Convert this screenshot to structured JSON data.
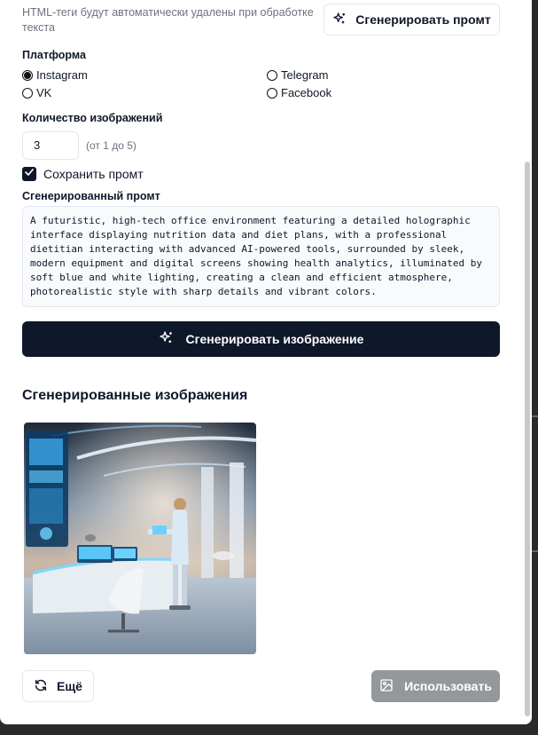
{
  "form": {
    "html_hint": "HTML-теги будут автоматически удалены при обработке текста",
    "generate_prompt_label": "Сгенерировать промт",
    "platform_label": "Платформа",
    "platforms": [
      {
        "label": "Instagram",
        "selected": true
      },
      {
        "label": "Telegram",
        "selected": false
      },
      {
        "label": "VK",
        "selected": false
      },
      {
        "label": "Facebook",
        "selected": false
      }
    ],
    "image_count_label": "Количество изображений",
    "image_count_value": "3",
    "image_count_range": "(от 1 до 5)",
    "save_prompt_label": "Сохранить промт",
    "save_prompt_checked": true,
    "generated_prompt_label": "Сгенерированный промт",
    "generated_prompt_text": "A futuristic, high-tech office environment featuring a detailed holographic interface displaying nutrition data and diet plans, with a professional dietitian interacting with advanced AI-powered tools, surrounded by sleek, modern equipment and digital screens showing health analytics, illuminated by soft blue and white lighting, creating a clean and efficient atmosphere, photorealistic style with sharp details and vibrant colors.",
    "generate_image_label": "Сгенерировать изображение"
  },
  "results": {
    "title": "Сгенерированные изображения",
    "more_label": "Ещё",
    "use_label": "Использовать"
  },
  "colors": {
    "primary": "#0f172a",
    "disabled_button": "#94979c",
    "muted_text": "#6b7280",
    "border": "#e2e8f0"
  },
  "icons": {
    "generate_prompt": "sparkles-icon",
    "generate_image": "sparkles-icon",
    "more": "refresh-icon",
    "use": "image-icon",
    "checkbox": "check-icon"
  }
}
